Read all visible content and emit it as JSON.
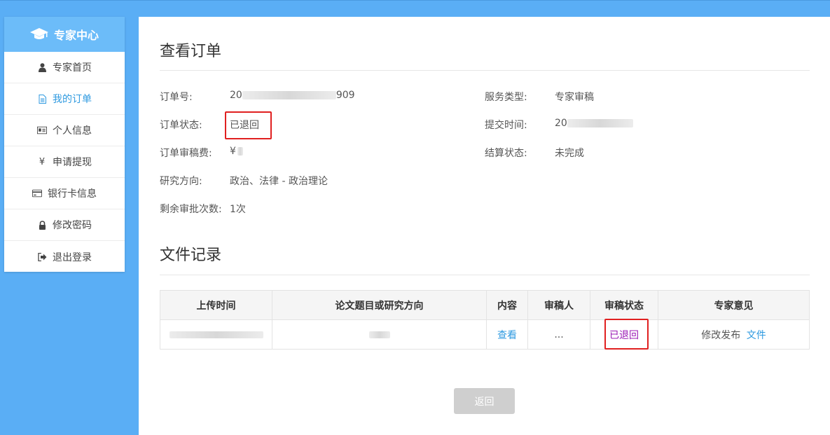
{
  "sidebar": {
    "title": "专家中心",
    "items": [
      {
        "label": "专家首页",
        "icon": "user-icon"
      },
      {
        "label": "我的订单",
        "icon": "document-icon"
      },
      {
        "label": "个人信息",
        "icon": "id-card-icon"
      },
      {
        "label": "申请提现",
        "icon": "yen-icon"
      },
      {
        "label": "银行卡信息",
        "icon": "credit-card-icon"
      },
      {
        "label": "修改密码",
        "icon": "lock-icon"
      },
      {
        "label": "退出登录",
        "icon": "logout-icon"
      }
    ],
    "active_index": 1
  },
  "order": {
    "section_title": "查看订单",
    "order_no_label": "订单号:",
    "order_no_prefix": "20",
    "order_no_suffix": "909",
    "service_type_label": "服务类型:",
    "service_type_value": "专家审稿",
    "status_label": "订单状态:",
    "status_value": "已退回",
    "submit_time_label": "提交时间:",
    "submit_time_prefix": "20",
    "fee_label": "订单审稿费:",
    "fee_prefix": "¥",
    "settle_label": "结算状态:",
    "settle_value": "未完成",
    "direction_label": "研究方向:",
    "direction_value": "政治、法律 - 政治理论",
    "remaining_label": "剩余审批次数:",
    "remaining_value": "1次"
  },
  "records": {
    "section_title": "文件记录",
    "headers": [
      "上传时间",
      "论文题目或研究方向",
      "内容",
      "审稿人",
      "审稿状态",
      "专家意见"
    ],
    "rows": [
      {
        "content_link": "查看",
        "reviewer": "...",
        "status": "已退回",
        "opinion_text": "修改发布",
        "opinion_link": "文件"
      }
    ]
  },
  "back_button": "返回",
  "colors": {
    "accent": "#2f9ae0",
    "status_purple": "#9b1bb5",
    "highlight_red": "#e02020",
    "background_blue": "#5aaef5"
  }
}
